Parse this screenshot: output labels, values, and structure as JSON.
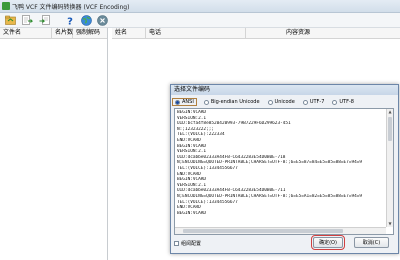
{
  "window": {
    "title": "飞鸭 VCF 文件编码转换器 (VCF Encoding)"
  },
  "toolbar": {
    "icons": [
      "open-folder-icon",
      "convert-icon",
      "export-icon",
      "help-icon",
      "globe-icon",
      "close-icon"
    ]
  },
  "left_pane": {
    "columns": [
      "文件名",
      "名片数",
      "强制解码"
    ]
  },
  "right_pane": {
    "columns": [
      "姓名",
      "电话",
      "内容资源"
    ]
  },
  "dialog": {
    "title": "选择文件编码",
    "encodings": [
      "ANSI",
      "Big-endian Unicode",
      "Unicode",
      "UTF-7",
      "UTF-8"
    ],
    "selected": "ANSI",
    "content_lines": [
      "BEGIN:VCARD",
      "VERSION:2.1",
      "UID:bcfa4f8e8520420993-79B7229F6D299623-451",
      "N:;12323222;;;",
      "TEL:(VOICE):222334",
      "END:VCARD",
      "BEGIN:VCARD",
      "VERSION:2.1",
      "UID:dcabbe02333A44FB-C6432283E54D0B0E-718",
      "N;ENCODING=QUOTED-PRINTABLE;CHARSET=UTF-8:;6=E5=87=84=E5=85=88=E7=94=9",
      "TEL:(VOICE):13344556677",
      "END:VCARD",
      "BEGIN:VCARD",
      "VERSION:2.1",
      "UID:dcabbe02333A44FB-C6432283E54D0B0E-711",
      "N;ENCODING=QUOTED-PRINTABLE;CHARSET=UTF-8:;6=E5=A1=82=E5=85=88=E7=94=9",
      "TEL:(VOICE):13344556677",
      "END:VCARD",
      "BEGIN:VCARD"
    ],
    "checkbox_label": "组阅配置",
    "ok_label": "确定(O)",
    "cancel_label": "取消(C)"
  }
}
